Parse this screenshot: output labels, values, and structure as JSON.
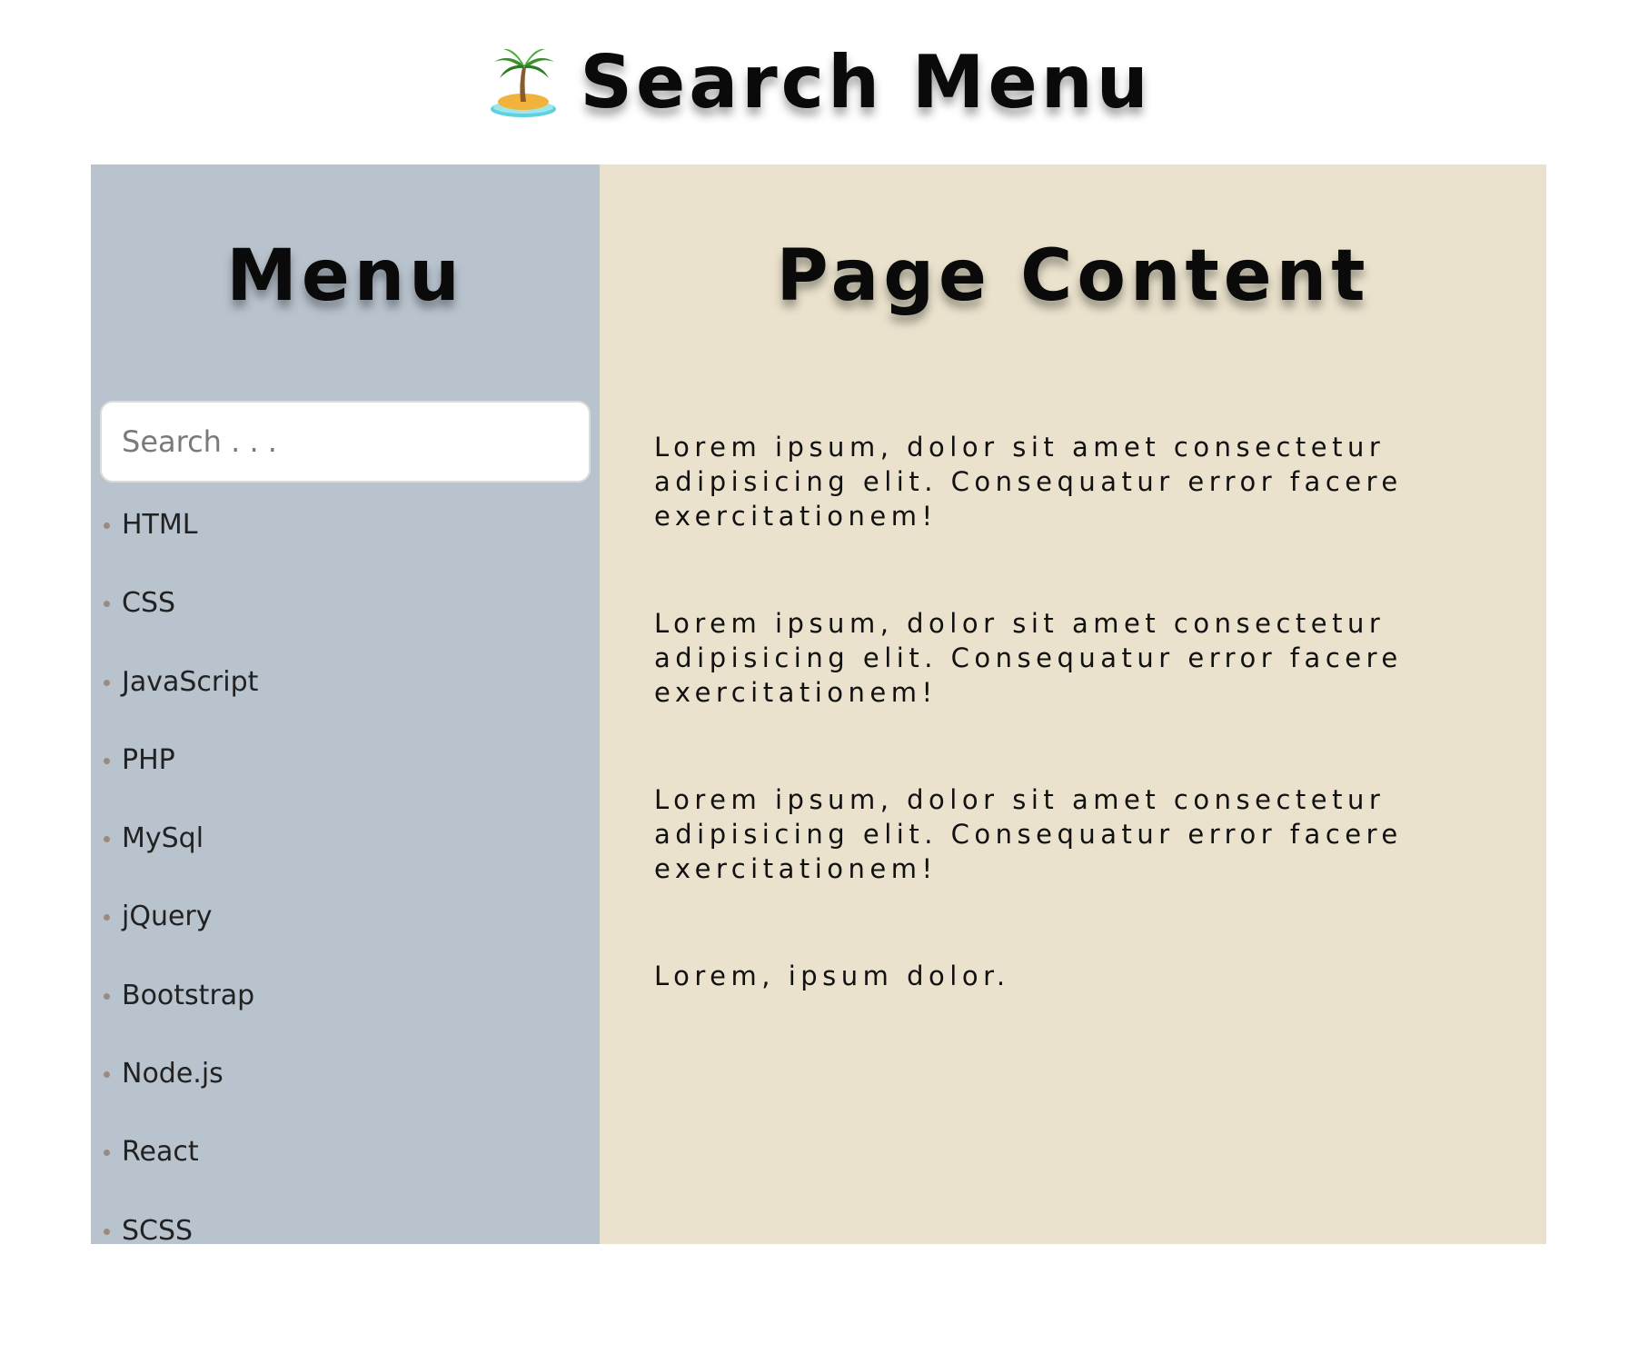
{
  "header": {
    "title": "Search Menu",
    "icon": "island-palm-icon"
  },
  "sidebar": {
    "heading": "Menu",
    "search": {
      "placeholder": "Search . . .",
      "value": ""
    },
    "items": [
      {
        "label": "HTML"
      },
      {
        "label": "CSS"
      },
      {
        "label": "JavaScript"
      },
      {
        "label": "PHP"
      },
      {
        "label": "MySql"
      },
      {
        "label": "jQuery"
      },
      {
        "label": "Bootstrap"
      },
      {
        "label": "Node.js"
      },
      {
        "label": "React"
      },
      {
        "label": "SCSS"
      }
    ]
  },
  "content": {
    "heading": "Page Content",
    "paragraphs": [
      "Lorem ipsum, dolor sit amet consectetur adipisicing elit. Consequatur error facere exercitationem!",
      "Lorem ipsum, dolor sit amet consectetur adipisicing elit. Consequatur error facere exercitationem!",
      "Lorem ipsum, dolor sit amet consectetur adipisicing elit. Consequatur error facere exercitationem!",
      "Lorem, ipsum dolor."
    ]
  },
  "colors": {
    "sidebar_background": "#b8c3ce",
    "content_background": "#eae2cc",
    "page_background": "#ffffff",
    "heading_text": "#0a0a0a",
    "bullet": "#9a8a80"
  }
}
